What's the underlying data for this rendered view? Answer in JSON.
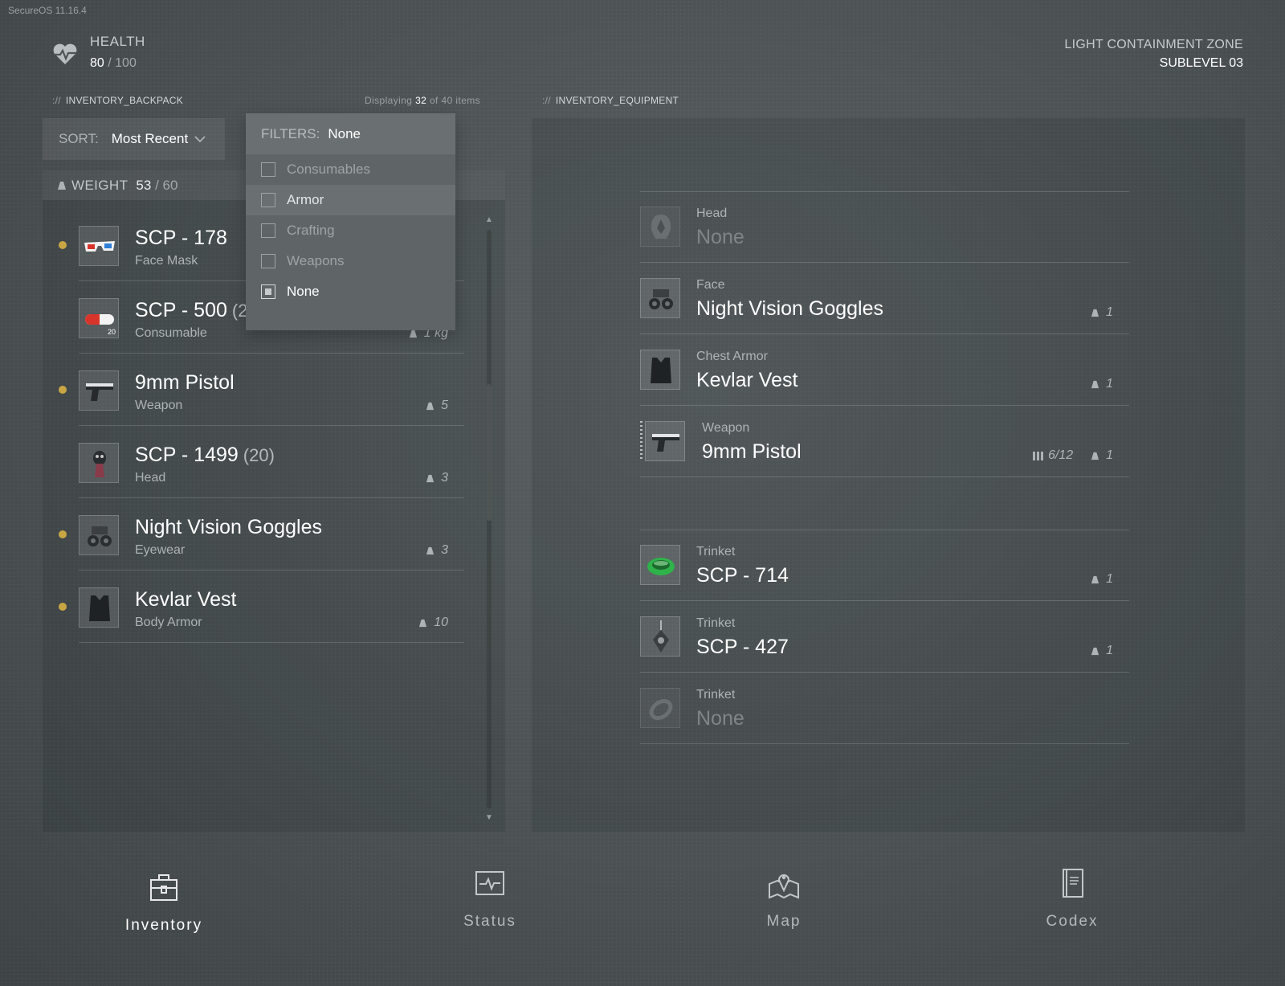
{
  "os_label": "SecureOS  11.16.4",
  "health": {
    "title": "HEALTH",
    "current": "80",
    "separator": "/ 100"
  },
  "zone": {
    "line1": "LIGHT CONTAINMENT ZONE",
    "line2": "SUBLEVEL 03"
  },
  "backpack": {
    "prefix": "://",
    "title": "INVENTORY_BACKPACK",
    "display_prefix": "Displaying",
    "display_count": "32",
    "display_suffix": "of 40 items",
    "sort_label": "SORT:",
    "sort_value": "Most Recent",
    "weight_label": "WEIGHT",
    "weight_current": "53",
    "weight_max": "/ 60",
    "items": [
      {
        "name": "SCP - 178",
        "qty": "",
        "type": "Face Mask",
        "weight": "",
        "new": true,
        "icon": "3d-glasses-icon"
      },
      {
        "name": "SCP - 500",
        "qty": "(2",
        "type": "Consumable",
        "weight": "1 kg",
        "new": false,
        "icon": "pill-icon",
        "badge": "20"
      },
      {
        "name": "9mm Pistol",
        "qty": "",
        "type": "Weapon",
        "weight": "5",
        "new": true,
        "icon": "pistol-icon"
      },
      {
        "name": "SCP - 1499",
        "qty": "(20)",
        "type": "Head",
        "weight": "3",
        "new": false,
        "icon": "gas-mask-icon"
      },
      {
        "name": "Night Vision Goggles",
        "qty": "",
        "type": "Eyewear",
        "weight": "3",
        "new": true,
        "icon": "goggles-icon"
      },
      {
        "name": "Kevlar Vest",
        "qty": "",
        "type": "Body Armor",
        "weight": "10",
        "new": true,
        "icon": "vest-icon"
      }
    ]
  },
  "filters": {
    "label": "FILTERS:",
    "value": "None",
    "options": [
      {
        "label": "Consumables",
        "checked": false
      },
      {
        "label": "Armor",
        "checked": false
      },
      {
        "label": "Crafting",
        "checked": false
      },
      {
        "label": "Weapons",
        "checked": false
      },
      {
        "label": "None",
        "checked": true
      }
    ]
  },
  "equipment": {
    "prefix": "://",
    "title": "INVENTORY_EQUIPMENT",
    "slots": [
      {
        "slot": "Head",
        "name": "None",
        "weight": ""
      },
      {
        "slot": "Face",
        "name": "Night Vision Goggles",
        "weight": "1"
      },
      {
        "slot": "Chest Armor",
        "name": "Kevlar Vest",
        "weight": "1"
      },
      {
        "slot": "Weapon",
        "name": "9mm Pistol",
        "ammo": "6/12",
        "weight": "1"
      },
      {
        "slot": "Trinket",
        "name": "SCP - 714",
        "weight": "1"
      },
      {
        "slot": "Trinket",
        "name": "SCP - 427",
        "weight": "1"
      },
      {
        "slot": "Trinket",
        "name": "None",
        "weight": ""
      }
    ]
  },
  "nav": [
    {
      "label": "Inventory",
      "icon": "briefcase-icon",
      "active": true
    },
    {
      "label": "Status",
      "icon": "heart-monitor-icon",
      "active": false
    },
    {
      "label": "Map",
      "icon": "map-pin-icon",
      "active": false
    },
    {
      "label": "Codex",
      "icon": "book-icon",
      "active": false
    }
  ],
  "colors": {
    "accent_new": "#c9a644",
    "text_muted": "#aeb3b5"
  }
}
